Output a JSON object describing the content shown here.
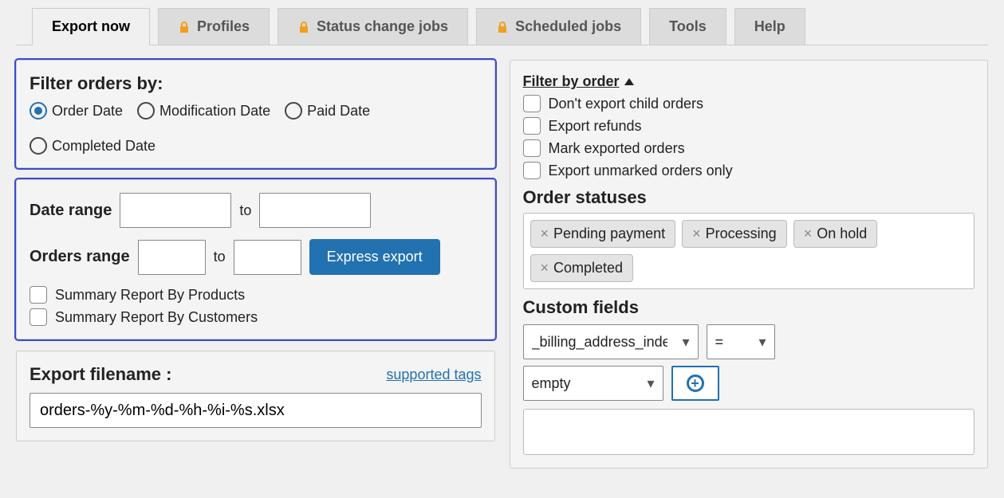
{
  "tabs": {
    "export_now": "Export now",
    "profiles": "Profiles",
    "status_change": "Status change jobs",
    "scheduled": "Scheduled jobs",
    "tools": "Tools",
    "help": "Help"
  },
  "filter_section": {
    "heading": "Filter orders by:",
    "options": {
      "order_date": "Order Date",
      "modification_date": "Modification Date",
      "paid_date": "Paid Date",
      "completed_date": "Completed Date"
    },
    "selected": "order_date"
  },
  "range_section": {
    "date_range_label": "Date range",
    "to": "to",
    "orders_range_label": "Orders range",
    "express_export": "Express export",
    "summary_products": "Summary Report By Products",
    "summary_customers": "Summary Report By Customers"
  },
  "filename_section": {
    "heading": "Export filename :",
    "supported_tags": "supported tags",
    "value": "orders-%y-%m-%d-%h-%i-%s.xlsx"
  },
  "right": {
    "header": "Filter by order",
    "checks": {
      "no_child": "Don't export child orders",
      "refunds": "Export refunds",
      "mark_exported": "Mark exported orders",
      "unmarked_only": "Export unmarked orders only"
    },
    "order_statuses_label": "Order statuses",
    "statuses": [
      "Pending payment",
      "Processing",
      "On hold",
      "Completed"
    ],
    "custom_fields_label": "Custom fields",
    "field_name": "_billing_address_index",
    "operator": "=",
    "value_select": "empty"
  }
}
